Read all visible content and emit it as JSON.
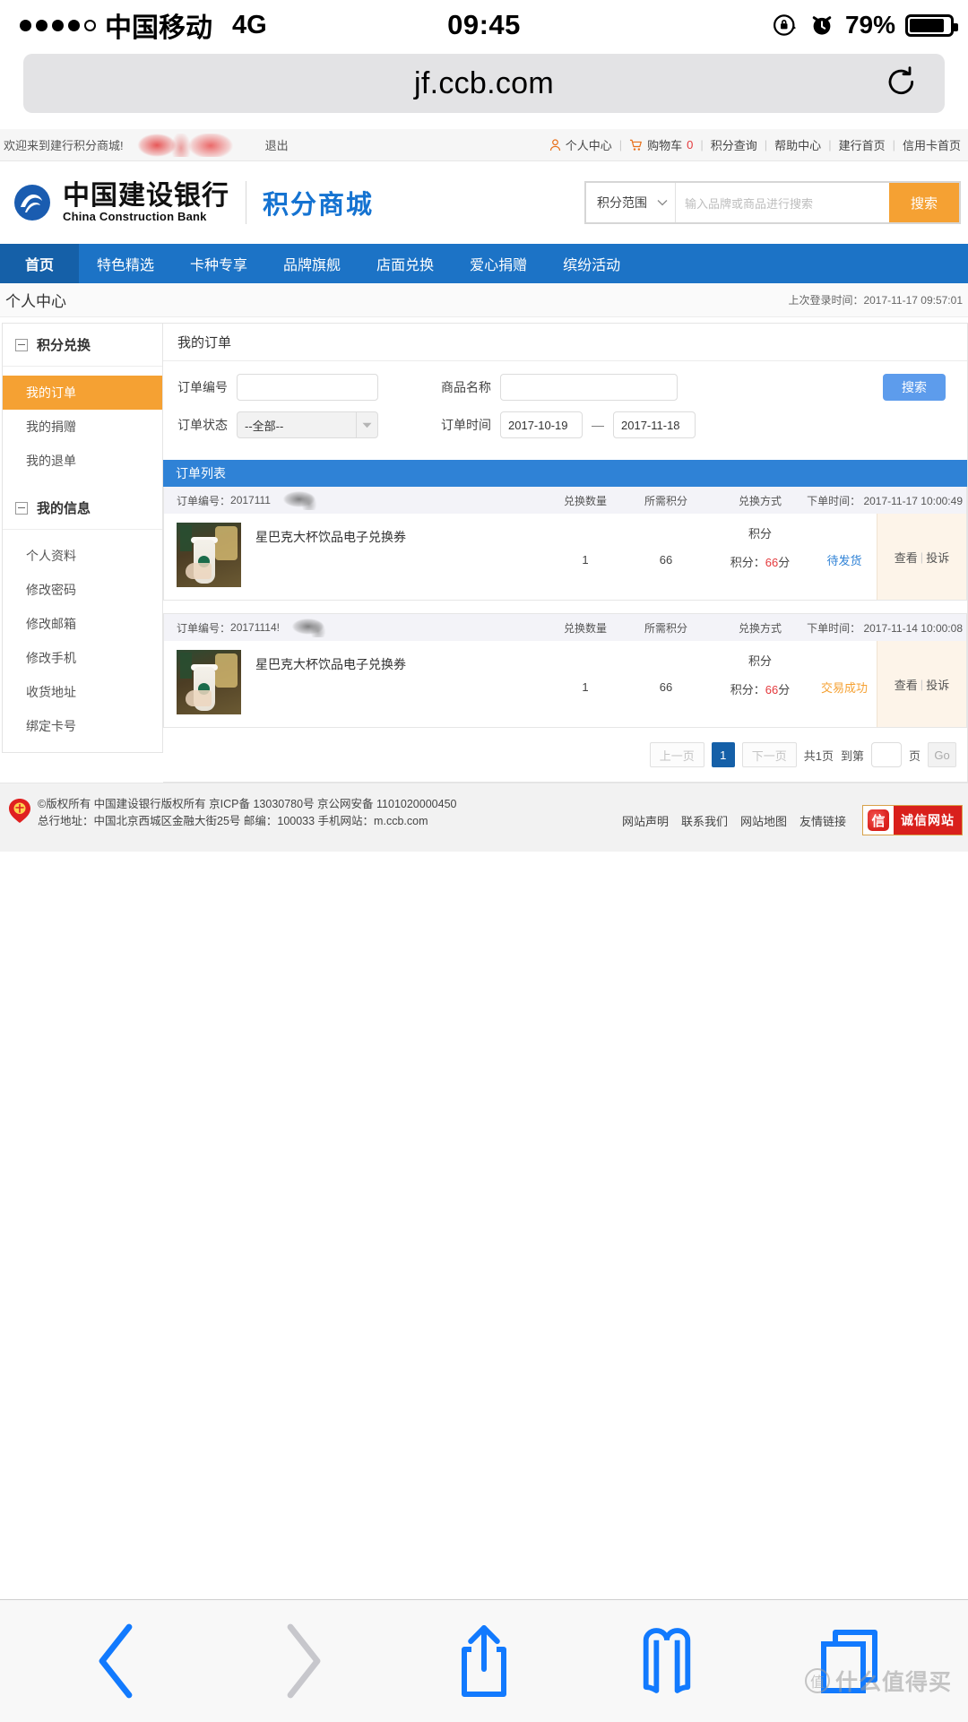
{
  "status_bar": {
    "carrier": "中国移动",
    "network": "4G",
    "time": "09:45",
    "battery_percent": "79%",
    "signal_dots_filled": 4,
    "signal_dots_total": 5,
    "icons": [
      "rotation-lock-icon",
      "alarm-icon",
      "battery-icon"
    ]
  },
  "browser": {
    "url": "jf.ccb.com",
    "reload_icon": "reload-icon",
    "toolbar": [
      {
        "name": "back-button",
        "icon": "chevron-left-icon",
        "enabled": true
      },
      {
        "name": "forward-button",
        "icon": "chevron-right-icon",
        "enabled": false
      },
      {
        "name": "share-button",
        "icon": "share-icon",
        "enabled": true
      },
      {
        "name": "bookmarks-button",
        "icon": "book-icon",
        "enabled": true
      },
      {
        "name": "tabs-button",
        "icon": "tabs-icon",
        "enabled": true
      }
    ]
  },
  "topbar": {
    "welcome": "欢迎来到建行积分商城!",
    "username_redacted": "",
    "logout": "退出",
    "links": [
      {
        "label": "个人中心",
        "icon": "user-icon"
      },
      {
        "label": "购物车",
        "icon": "cart-icon",
        "count": "0"
      },
      {
        "label": "积分查询"
      },
      {
        "label": "帮助中心"
      },
      {
        "label": "建行首页"
      },
      {
        "label": "信用卡首页"
      }
    ]
  },
  "brand": {
    "bank_cn": "中国建设银行",
    "bank_en": "China Construction Bank",
    "mall": "积分商城",
    "logo_icon": "ccb-logo-icon"
  },
  "search": {
    "scope_label": "积分范围",
    "scope_caret": "chevron-down-icon",
    "placeholder": "输入品牌或商品进行搜索",
    "value": "",
    "button": "搜索"
  },
  "nav": {
    "items": [
      {
        "label": "首页",
        "active": true
      },
      {
        "label": "特色精选",
        "active": false
      },
      {
        "label": "卡种专享",
        "active": false
      },
      {
        "label": "品牌旗舰",
        "active": false
      },
      {
        "label": "店面兑换",
        "active": false
      },
      {
        "label": "爱心捐赠",
        "active": false
      },
      {
        "label": "缤纷活动",
        "active": false
      }
    ]
  },
  "breadcrumb": {
    "title": "个人中心",
    "last_login": "上次登录时间：2017-11-17 09:57:01"
  },
  "sidebar": {
    "groups": [
      {
        "title": "积分兑换",
        "items": [
          {
            "label": "我的订单",
            "active": true
          },
          {
            "label": "我的捐赠",
            "active": false
          },
          {
            "label": "我的退单",
            "active": false
          }
        ]
      },
      {
        "title": "我的信息",
        "items": [
          {
            "label": "个人资料",
            "active": false
          },
          {
            "label": "修改密码",
            "active": false
          },
          {
            "label": "修改邮箱",
            "active": false
          },
          {
            "label": "修改手机",
            "active": false
          },
          {
            "label": "收货地址",
            "active": false
          },
          {
            "label": "绑定卡号",
            "active": false
          }
        ]
      }
    ]
  },
  "main": {
    "title": "我的订单",
    "filters": {
      "order_no_label": "订单编号",
      "order_no_value": "",
      "product_label": "商品名称",
      "product_value": "",
      "status_label": "订单状态",
      "status_value": "--全部--",
      "time_label": "订单时间",
      "date_from": "2017-10-19",
      "date_to": "2017-11-18",
      "date_sep": "—",
      "search_button": "搜索"
    },
    "list_header": "订单列表",
    "column_headers": {
      "order_no": "订单编号：",
      "qty": "兑换数量",
      "points": "所需积分",
      "method": "兑换方式",
      "order_time": "下单时间："
    },
    "orders": [
      {
        "order_no_prefix": "2017111",
        "order_time": "2017-11-17 10:00:49",
        "product_name": "星巴克大杯饮品电子兑换券",
        "qty": "1",
        "points": "66",
        "method_label": "积分",
        "method_detail_label": "积分：",
        "method_detail_value": "66",
        "method_detail_unit": "分",
        "status": "待发货",
        "status_color": "#2f82d6",
        "action_view": "查看",
        "action_complain": "投诉",
        "thumb_icon": "starbucks-cup-thumb"
      },
      {
        "order_no_prefix": "20171114!",
        "order_time": "2017-11-14 10:00:08",
        "product_name": "星巴克大杯饮品电子兑换券",
        "qty": "1",
        "points": "66",
        "method_label": "积分",
        "method_detail_label": "积分：",
        "method_detail_value": "66",
        "method_detail_unit": "分",
        "status": "交易成功",
        "status_color": "#f5a133",
        "action_view": "查看",
        "action_complain": "投诉",
        "thumb_icon": "starbucks-cup-thumb"
      }
    ],
    "pager": {
      "prev": "上一页",
      "current": "1",
      "next": "下一页",
      "total_text": "共1页",
      "goto_label": "到第",
      "goto_value": "",
      "page_unit": "页",
      "go": "Go"
    }
  },
  "footer": {
    "line1": "©版权所有 中国建设银行版权所有 京ICP备 13030780号 京公网安备 1101020000450",
    "line2": "总行地址：中国北京西城区金融大街25号 邮编：100033 手机网站：m.ccb.com",
    "links": [
      "网站声明",
      "联系我们",
      "网站地图",
      "友情链接"
    ],
    "badge_glyph": "信",
    "badge_text": "诚信网站",
    "emblem_icon": "national-emblem-icon"
  },
  "watermark": {
    "glyph": "值",
    "text": "什么值得买"
  },
  "colors": {
    "nav_blue": "#1c73c6",
    "nav_active_blue": "#1560a8",
    "accent_orange": "#f5a133",
    "link_red": "#e4393c",
    "list_header_blue": "#2f82d6",
    "search_button_blue": "#5d9cec"
  }
}
